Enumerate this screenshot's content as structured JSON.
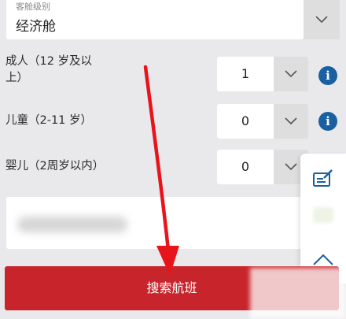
{
  "cabin": {
    "caption": "客舱级别",
    "value": "经济舱",
    "icon": "chevron-down-icon"
  },
  "passengers": [
    {
      "label_line1": "成人（12 岁及以",
      "label_line2": "上）",
      "count": "1",
      "info_icon": "info-icon"
    },
    {
      "label_line1": "儿童（2-11 岁）",
      "count": "0",
      "info_icon": "info-icon"
    },
    {
      "label_line1": "婴儿（2周岁以内）",
      "count": "0"
    }
  ],
  "promo": {
    "value": ""
  },
  "toolbar": {
    "icons": [
      "edit-note-icon",
      "blank-icon",
      "chevron-up-icon"
    ]
  },
  "search_button": {
    "label": "搜索航班"
  },
  "colors": {
    "primary_red": "#c8242b",
    "info_blue": "#1a5fa0",
    "arrow_red": "#e8141c",
    "background": "#e9e9eb"
  }
}
